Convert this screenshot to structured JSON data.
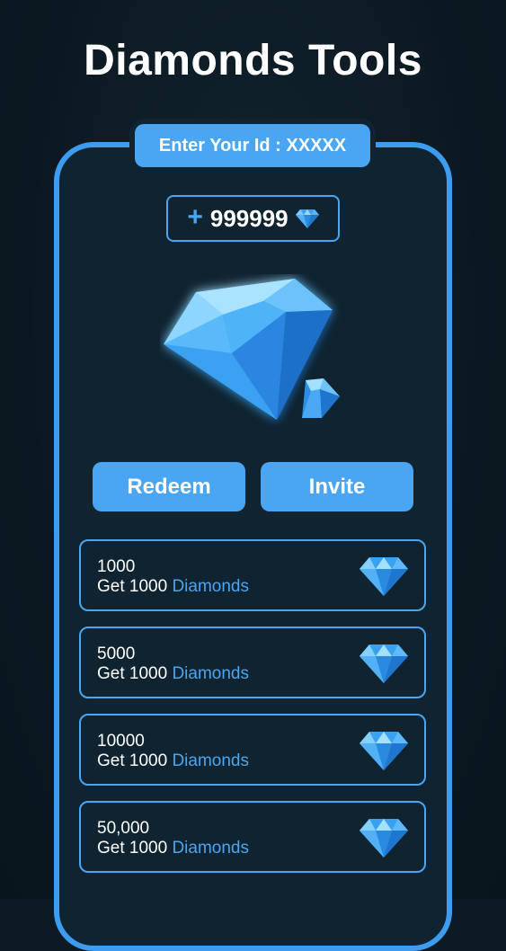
{
  "page": {
    "title": "Diamonds Tools"
  },
  "id_banner": {
    "label": "Enter Your Id : XXXXX"
  },
  "balance": {
    "plus_symbol": "+",
    "value": "999999",
    "icon": "diamond-icon"
  },
  "actions": {
    "redeem_label": "Redeem",
    "invite_label": "Invite"
  },
  "offers": [
    {
      "amount": "1000",
      "desc_prefix": "Get 1000",
      "desc_accent": "Diamonds",
      "icon": "diamond-icon"
    },
    {
      "amount": "5000",
      "desc_prefix": "Get 1000",
      "desc_accent": "Diamonds",
      "icon": "diamond-icon"
    },
    {
      "amount": "10000",
      "desc_prefix": "Get 1000",
      "desc_accent": "Diamonds",
      "icon": "diamond-icon"
    },
    {
      "amount": "50,000",
      "desc_prefix": "Get 1000",
      "desc_accent": "Diamonds",
      "icon": "diamond-icon"
    }
  ],
  "colors": {
    "background": "#0c1a24",
    "accent": "#4aa6f2",
    "panel": "#0f2330",
    "text": "#ffffff"
  }
}
